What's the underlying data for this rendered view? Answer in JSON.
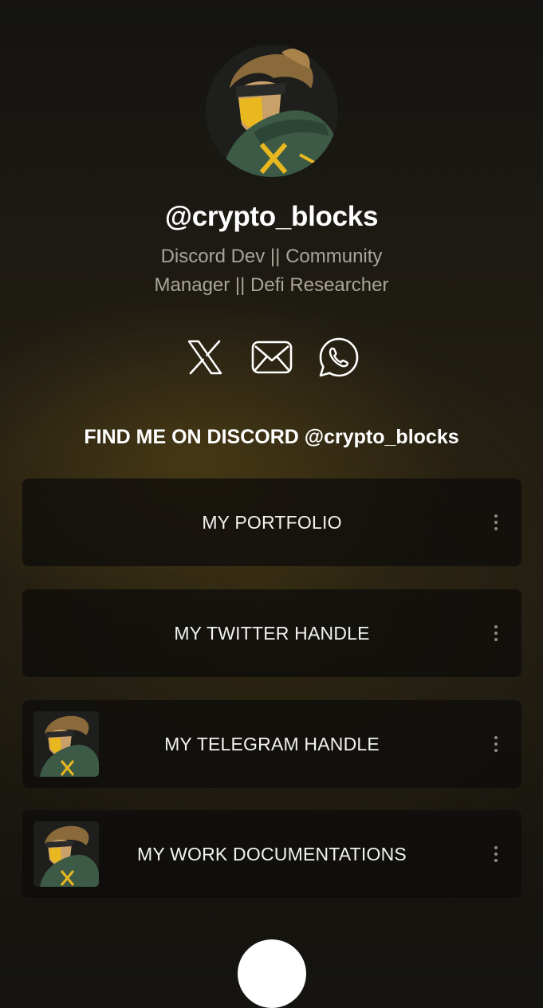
{
  "profile": {
    "handle": "@crypto_blocks",
    "bio": "Discord Dev || Community Manager || Defi Researcher"
  },
  "socials": [
    {
      "icon": "x-logo-icon"
    },
    {
      "icon": "mail-icon"
    },
    {
      "icon": "whatsapp-icon"
    }
  ],
  "discord_heading": "FIND ME ON DISCORD @crypto_blocks",
  "links": [
    {
      "label": "MY PORTFOLIO",
      "has_thumbnail": false
    },
    {
      "label": "MY TWITTER HANDLE",
      "has_thumbnail": false
    },
    {
      "label": "MY TELEGRAM HANDLE",
      "has_thumbnail": true
    },
    {
      "label": "MY WORK DOCUMENTATIONS",
      "has_thumbnail": true
    }
  ],
  "colors": {
    "accent_yellow": "#e9b71f",
    "jacket_green": "#3c5a45",
    "bio_text": "#a9a59c",
    "card_bg": "#0e0d0b"
  }
}
